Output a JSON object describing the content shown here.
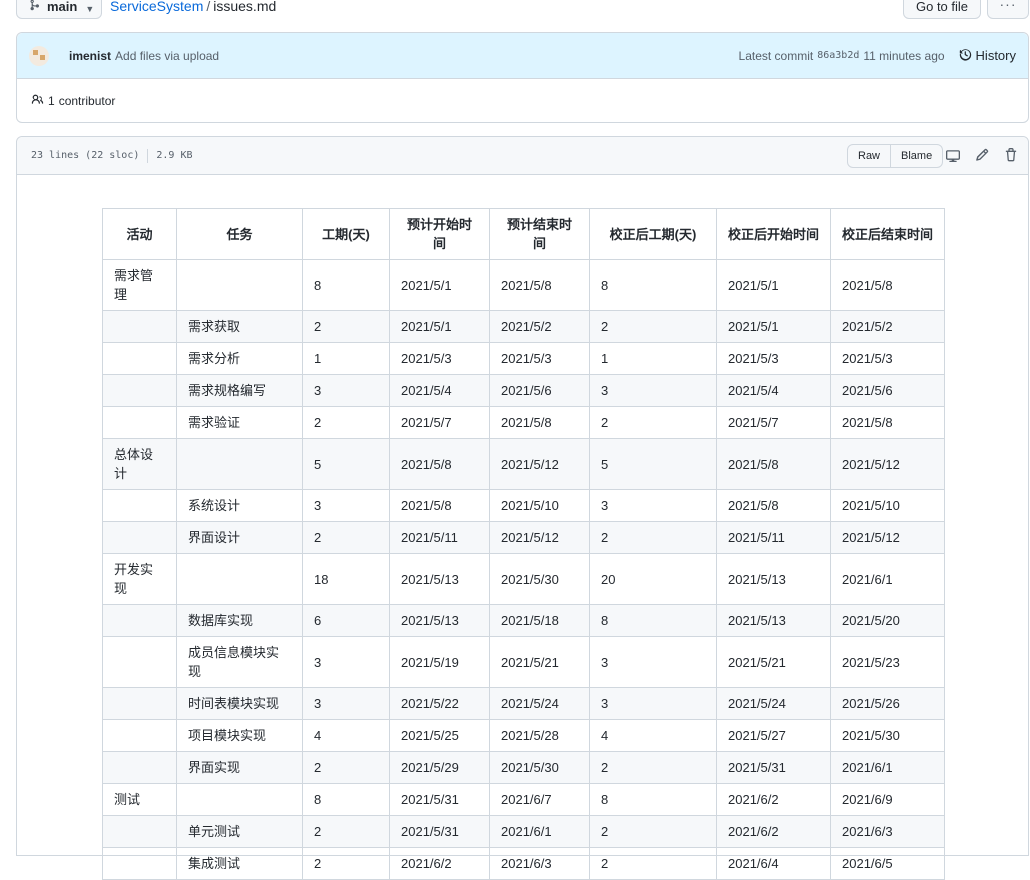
{
  "topbar": {
    "branch": "main",
    "repo": "ServiceSystem",
    "separator": "/",
    "file": "issues.md",
    "goto_file": "Go to file",
    "more": "···"
  },
  "commit": {
    "author": "imenist",
    "message": "Add files via upload",
    "latest_label": "Latest commit",
    "sha": "86a3b2d",
    "time": "11 minutes ago",
    "history": "History"
  },
  "contributors": {
    "count": "1",
    "label": "contributor"
  },
  "file_header": {
    "lines": "23 lines (22 sloc)",
    "size": "2.9 KB",
    "raw": "Raw",
    "blame": "Blame"
  },
  "table": {
    "headers": [
      "活动",
      "任务",
      "工期(天)",
      "预计开始时间",
      "预计结束时间",
      "校正后工期(天)",
      "校正后开始时间",
      "校正后结束时间"
    ],
    "rows": [
      [
        "需求管理",
        "",
        "8",
        "2021/5/1",
        "2021/5/8",
        "8",
        "2021/5/1",
        "2021/5/8"
      ],
      [
        "",
        "需求获取",
        "2",
        "2021/5/1",
        "2021/5/2",
        "2",
        "2021/5/1",
        "2021/5/2"
      ],
      [
        "",
        "需求分析",
        "1",
        "2021/5/3",
        "2021/5/3",
        "1",
        "2021/5/3",
        "2021/5/3"
      ],
      [
        "",
        "需求规格编写",
        "3",
        "2021/5/4",
        "2021/5/6",
        "3",
        "2021/5/4",
        "2021/5/6"
      ],
      [
        "",
        "需求验证",
        "2",
        "2021/5/7",
        "2021/5/8",
        "2",
        "2021/5/7",
        "2021/5/8"
      ],
      [
        "总体设计",
        "",
        "5",
        "2021/5/8",
        "2021/5/12",
        "5",
        "2021/5/8",
        "2021/5/12"
      ],
      [
        "",
        "系统设计",
        "3",
        "2021/5/8",
        "2021/5/10",
        "3",
        "2021/5/8",
        "2021/5/10"
      ],
      [
        "",
        "界面设计",
        "2",
        "2021/5/11",
        "2021/5/12",
        "2",
        "2021/5/11",
        "2021/5/12"
      ],
      [
        "开发实现",
        "",
        "18",
        "2021/5/13",
        "2021/5/30",
        "20",
        "2021/5/13",
        "2021/6/1"
      ],
      [
        "",
        "数据库实现",
        "6",
        "2021/5/13",
        "2021/5/18",
        "8",
        "2021/5/13",
        "2021/5/20"
      ],
      [
        "",
        "成员信息模块实现",
        "3",
        "2021/5/19",
        "2021/5/21",
        "3",
        "2021/5/21",
        "2021/5/23"
      ],
      [
        "",
        "时间表模块实现",
        "3",
        "2021/5/22",
        "2021/5/24",
        "3",
        "2021/5/24",
        "2021/5/26"
      ],
      [
        "",
        "项目模块实现",
        "4",
        "2021/5/25",
        "2021/5/28",
        "4",
        "2021/5/27",
        "2021/5/30"
      ],
      [
        "",
        "界面实现",
        "2",
        "2021/5/29",
        "2021/5/30",
        "2",
        "2021/5/31",
        "2021/6/1"
      ],
      [
        "测试",
        "",
        "8",
        "2021/5/31",
        "2021/6/7",
        "8",
        "2021/6/2",
        "2021/6/9"
      ],
      [
        "",
        "单元测试",
        "2",
        "2021/5/31",
        "2021/6/1",
        "2",
        "2021/6/2",
        "2021/6/3"
      ],
      [
        "",
        "集成测试",
        "2",
        "2021/6/2",
        "2021/6/3",
        "2",
        "2021/6/4",
        "2021/6/5"
      ]
    ]
  },
  "colors": {
    "link": "#0969da",
    "commit_bg": "#ddf4ff",
    "border": "#d0d7de",
    "stripe": "#f6f8fa"
  }
}
